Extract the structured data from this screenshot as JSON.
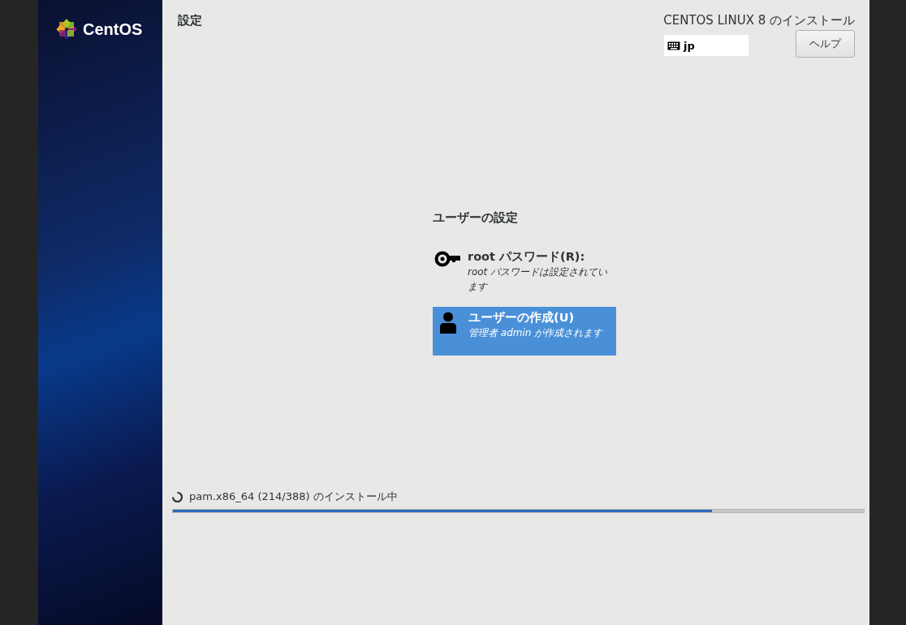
{
  "sidebar": {
    "logo_text": "CentOS"
  },
  "header": {
    "title": "設定",
    "product": "CENTOS LINUX 8 のインストール",
    "keyboard": "jp",
    "help_button": "ヘルプ"
  },
  "section": {
    "title": "ユーザーの設定",
    "spokes": [
      {
        "kind": "key",
        "title": "root パスワード(R):",
        "status": "root パスワードは設定されています",
        "selected": false
      },
      {
        "kind": "user",
        "title": "ユーザーの作成(U)",
        "status": "管理者 admin が作成されます",
        "selected": true
      }
    ]
  },
  "progress": {
    "message": "pam.x86_64 (214/388) のインストール中",
    "level": 0.78
  }
}
